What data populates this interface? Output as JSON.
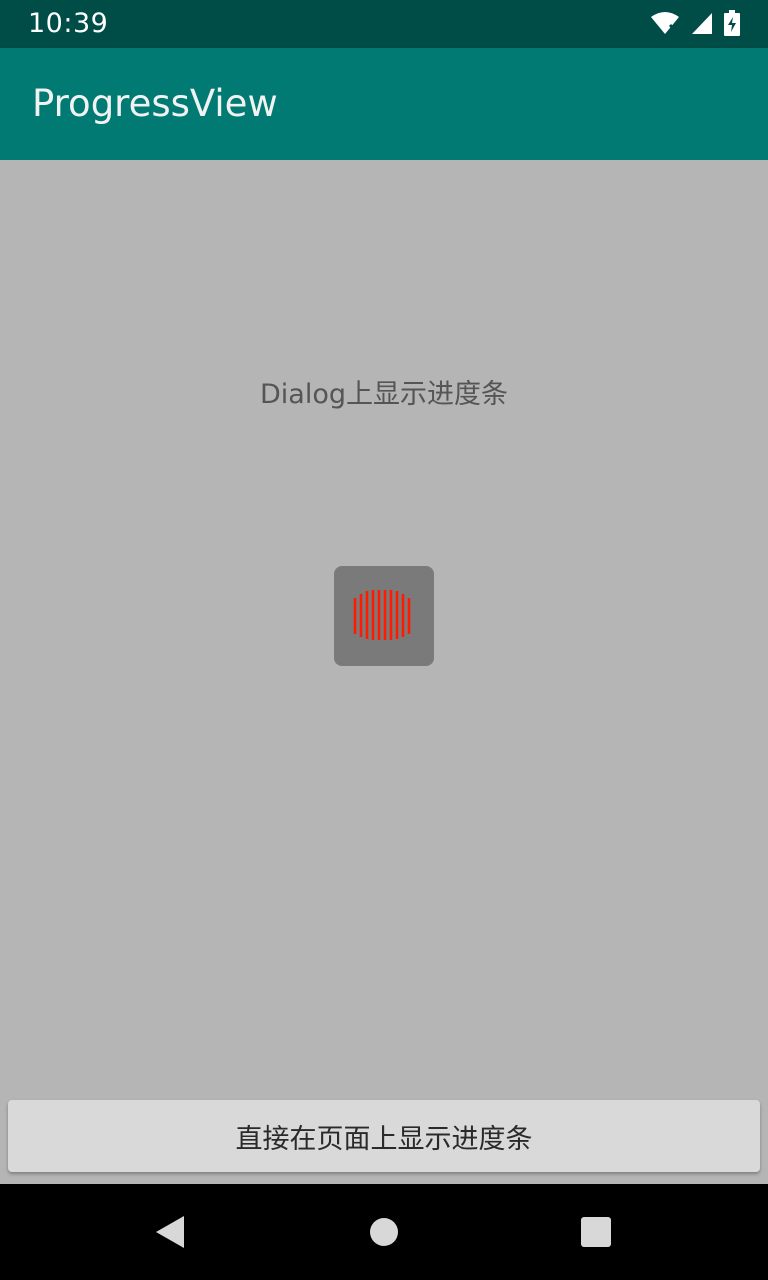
{
  "status_bar": {
    "time": "10:39",
    "icons": [
      "wifi-icon",
      "cellular-signal-icon",
      "battery-charging-icon"
    ]
  },
  "app_bar": {
    "title": "ProgressView",
    "color": "#007a72"
  },
  "content": {
    "dialog_label": "Dialog上显示进度条",
    "progress_indicator": {
      "icon": "loading-bars-icon",
      "bar_color": "#ff1a00"
    },
    "page_button_label": "直接在页面上显示进度条"
  },
  "nav_bar": {
    "buttons": [
      "back-icon",
      "home-icon",
      "recents-icon"
    ]
  }
}
